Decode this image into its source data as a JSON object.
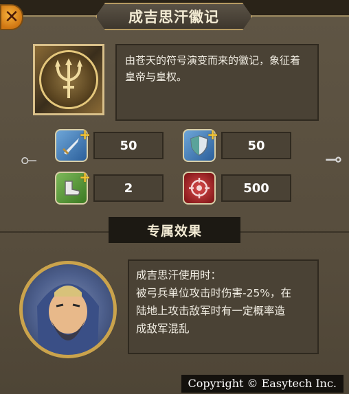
{
  "title": "成吉思汗徽记",
  "emblem": {
    "icon": "trident-emblem-icon"
  },
  "description": "由苍天的符号演变而来的徽记，象征着皇帝与皇权。",
  "stats": [
    {
      "icon": "sword-icon",
      "value": "50",
      "color": "#3d78b5"
    },
    {
      "icon": "shield-icon",
      "value": "50",
      "color": "#3d78b5"
    },
    {
      "icon": "boot-icon",
      "value": "2",
      "color": "#4b8a2c"
    },
    {
      "icon": "crosshair-icon",
      "value": "500",
      "color": "#9b1f22"
    }
  ],
  "section_title": "专属效果",
  "portrait": {
    "icon": "general-portrait"
  },
  "effect": {
    "line1": "成吉思汗使用时：",
    "line2": "被弓兵单位攻击时伤害-25%，在",
    "line3": "陆地上攻击敌军时有一定概率造",
    "line4": "成敌军混乱"
  },
  "copyright": "Copyright © Easytech Inc.",
  "close_label": "✕"
}
